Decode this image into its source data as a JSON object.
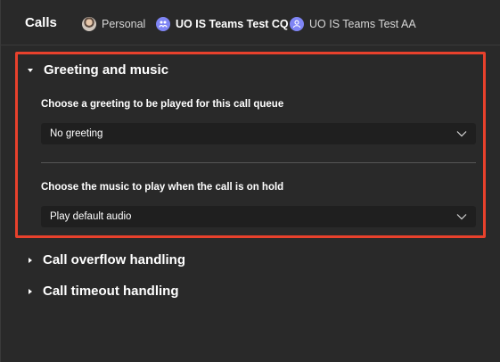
{
  "header": {
    "title": "Calls",
    "accounts": [
      {
        "label": "Personal",
        "icon": "user-photo-avatar"
      },
      {
        "label": "UO IS Teams Test CQ",
        "icon": "call-queue-icon"
      },
      {
        "label": "UO IS Teams Test AA",
        "icon": "auto-attendant-icon"
      }
    ]
  },
  "sections": {
    "greeting": {
      "title": "Greeting and music",
      "expanded": true,
      "greeting_label": "Choose a greeting to be played for this call queue",
      "greeting_value": "No greeting",
      "music_label": "Choose the music to play when the call is on hold",
      "music_value": "Play default audio"
    },
    "overflow": {
      "title": "Call overflow handling",
      "expanded": false
    },
    "timeout": {
      "title": "Call timeout handling",
      "expanded": false
    }
  },
  "colors": {
    "highlight": "#e8412c",
    "background": "#292929",
    "dropdown_bg": "#1f1f1f",
    "team_avatar": "#7f85f5"
  }
}
